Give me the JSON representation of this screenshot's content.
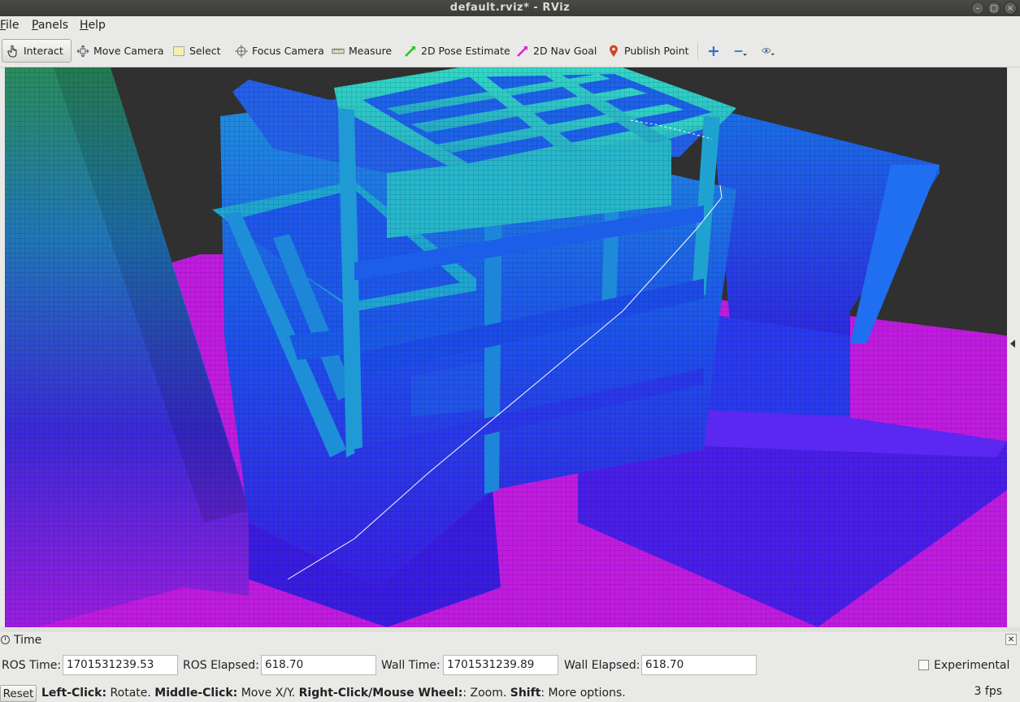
{
  "window": {
    "title": "default.rviz* - RViz",
    "buttons": [
      "–",
      "□",
      "×"
    ]
  },
  "menu": [
    {
      "label": "File"
    },
    {
      "label": "Panels"
    },
    {
      "label": "Help"
    }
  ],
  "toolbar": {
    "interact": "Interact",
    "move_camera": "Move Camera",
    "select": "Select",
    "focus_camera": "Focus Camera",
    "measure": "Measure",
    "pose_estimate": "2D Pose Estimate",
    "nav_goal": "2D Nav Goal",
    "publish_point": "Publish Point",
    "active_tool": "Interact",
    "colors": {
      "pose_estimate": "#26c426",
      "nav_goal": "#e020c8",
      "publish_point": "#d0451f",
      "zoom_icons": "#2d6fd0"
    }
  },
  "viewport": {
    "content": "3D occupancy voxel map of a multi-storey building frame with height-colored cubes",
    "colors": {
      "background": "#303030",
      "ground": "#c21ce2",
      "low": "#3a18e6",
      "mid": "#1f6ff0",
      "high": "#2ec9c0",
      "top": "#28a060"
    }
  },
  "time_panel": {
    "title": "Time",
    "ros_time_label": "ROS Time:",
    "ros_time": "1701531239.53",
    "ros_elapsed_label": "ROS Elapsed:",
    "ros_elapsed": "618.70",
    "wall_time_label": "Wall Time:",
    "wall_time": "1701531239.89",
    "wall_elapsed_label": "Wall Elapsed:",
    "wall_elapsed": "618.70",
    "experimental_label": "Experimental",
    "experimental_checked": false
  },
  "status": {
    "reset": "Reset",
    "left_click": "Left-Click:",
    "left_click_text": " Rotate. ",
    "middle_click": "Middle-Click:",
    "middle_click_text": " Move X/Y. ",
    "right_click": "Right-Click/Mouse Wheel:",
    "right_click_text": ": Zoom. ",
    "shift": "Shift",
    "shift_text": ": More options.",
    "fps": "3 fps"
  }
}
